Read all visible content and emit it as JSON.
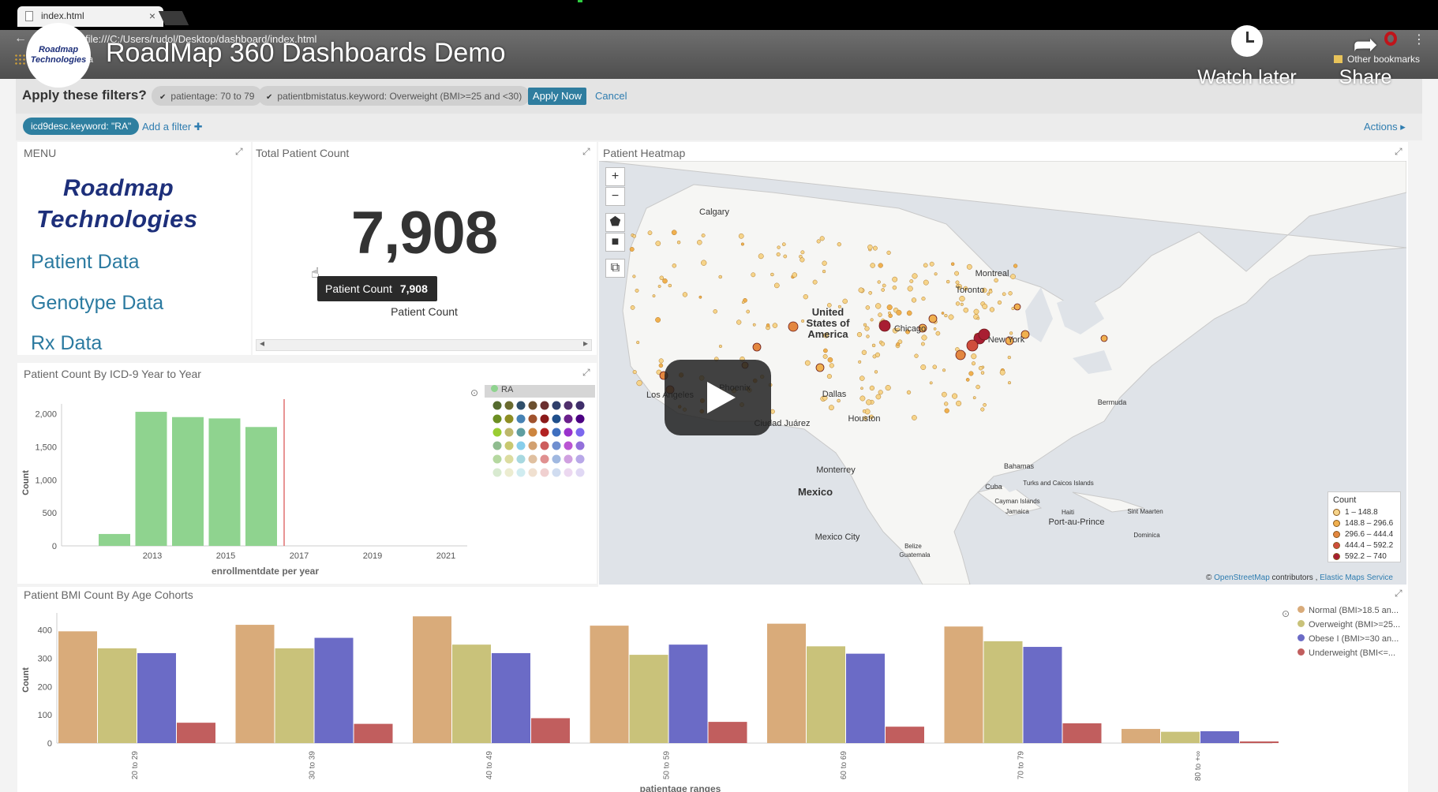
{
  "browser": {
    "tab_title": "index.html",
    "tab_close": "×",
    "url": "file:///C:/Users/rudol/Desktop/dashboard/index.html",
    "bookmarks_label": "ck a",
    "other_bookmarks": "Other bookmarks"
  },
  "video": {
    "channel_logo_line1": "Roadmap",
    "channel_logo_line2": "Technologies",
    "title": "RoadMap 360 Dashboards Demo",
    "watch_later": "Watch later",
    "share": "Share"
  },
  "filters": {
    "prompt": "Apply these filters?",
    "pending": [
      "patientage: 70 to 79",
      "patientbmistatus.keyword: Overweight (BMI>=25 and <30)"
    ],
    "apply_label": "Apply Now",
    "cancel_label": "Cancel",
    "active_chip": "icd9desc.keyword: \"RA\"",
    "add_filter": "Add a filter ✚",
    "actions": "Actions ▸"
  },
  "menu": {
    "title": "MENU",
    "logo_line1": "Roadmap",
    "logo_line2": "Technologies",
    "links": [
      "Patient Data",
      "Genotype Data",
      "Rx Data"
    ]
  },
  "total_count": {
    "title": "Total Patient Count",
    "value": "7,908",
    "tooltip_label": "Patient Count",
    "tooltip_value": "7,908",
    "label": "Patient Count"
  },
  "heatmap": {
    "title": "Patient Heatmap",
    "zoom_in": "+",
    "zoom_out": "−",
    "places": [
      "Calgary",
      "United",
      "States of",
      "America",
      "Chicago",
      "Toronto",
      "Montreal",
      "New York",
      "Phoenix",
      "Los Angeles",
      "Dallas",
      "Houston",
      "Ciudad Juárez",
      "Monterrey",
      "Mexico",
      "Mexico City",
      "Bermuda",
      "Bahamas",
      "Cuba",
      "Turks and Caicos Islands",
      "Cayman Islands",
      "Jamaica",
      "Haiti",
      "Port-au-Prince",
      "Sint Maarten",
      "Dominica",
      "Belize",
      "Guatemala"
    ],
    "legend_title": "Count",
    "legend": [
      {
        "label": "1 – 148.8",
        "color": "#f6d48a"
      },
      {
        "label": "148.8 – 296.6",
        "color": "#f0b04f"
      },
      {
        "label": "296.6 – 444.4",
        "color": "#e38740"
      },
      {
        "label": "444.4 – 592.2",
        "color": "#cf4d3c"
      },
      {
        "label": "592.2 – 740",
        "color": "#a81e32"
      }
    ],
    "attribution_prefix": "© ",
    "attribution_osm": "OpenStreetMap",
    "attribution_mid": " contributors , ",
    "attribution_ems": "Elastic Maps Service"
  },
  "year_chart": {
    "title": "Patient Count By ICD-9 Year to Year",
    "series_swatch_label": "RA"
  },
  "bmi_chart": {
    "title": "Patient BMI Count By Age Cohorts"
  },
  "chart_data": [
    {
      "type": "bar",
      "categories": [
        "2012",
        "2013",
        "2014",
        "2015",
        "2016"
      ],
      "values": [
        180,
        2030,
        1950,
        1930,
        1800
      ],
      "xticks": [
        "2013",
        "2015",
        "2017",
        "2019",
        "2021"
      ],
      "xlabel": "enrollmentdate per year",
      "ylabel": "Count",
      "yticks": [
        "0",
        "500",
        "1,000",
        "1,500",
        "2,000"
      ],
      "ylim": [
        0,
        2150
      ],
      "color": "#8fd38f",
      "marker_color": "#e07070"
    },
    {
      "type": "bar",
      "categories": [
        "20 to 29",
        "30 to 39",
        "40 to 49",
        "50 to 59",
        "60 to 69",
        "70 to 79",
        "80 to +∞"
      ],
      "xlabel": "patientage ranges",
      "ylabel": "Count",
      "yticks": [
        "0",
        "100",
        "200",
        "300",
        "400"
      ],
      "ylim": [
        0,
        460
      ],
      "series": [
        {
          "name": "Normal (BMI>18.5 an...",
          "color": "#d9ab7a",
          "values": [
            395,
            418,
            448,
            415,
            422,
            412,
            50
          ]
        },
        {
          "name": "Overweight (BMI>=25...",
          "color": "#c9c27a",
          "values": [
            335,
            335,
            348,
            312,
            342,
            360,
            40
          ]
        },
        {
          "name": "Obese I (BMI>=30 an...",
          "color": "#6b6bc6",
          "values": [
            318,
            372,
            318,
            348,
            316,
            340,
            42
          ]
        },
        {
          "name": "Underweight (BMI<=...",
          "color": "#c15e5e",
          "values": [
            72,
            68,
            88,
            75,
            58,
            70,
            6
          ]
        }
      ]
    }
  ]
}
